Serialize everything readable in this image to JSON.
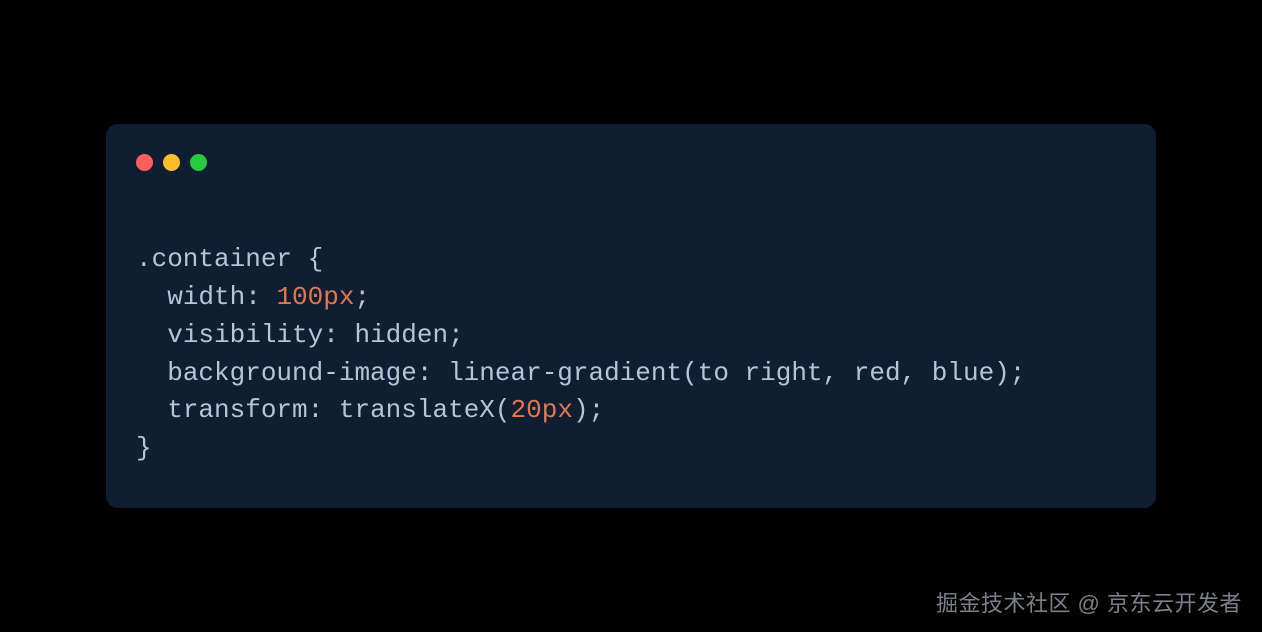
{
  "code": {
    "line1_selector": ".container",
    "line1_brace_open": " {",
    "line2_indent": "  ",
    "line2_prop": "width",
    "line2_colon": ": ",
    "line2_num": "100",
    "line2_unit": "px",
    "line2_semi": ";",
    "line3_indent": "  ",
    "line3_prop": "visibility",
    "line3_colon": ": ",
    "line3_val": "hidden",
    "line3_semi": ";",
    "line4_indent": "  ",
    "line4_prop": "background-image",
    "line4_colon": ": ",
    "line4_val": "linear-gradient(to right, red, blue)",
    "line4_semi": ";",
    "line5_indent": "  ",
    "line5_prop": "transform",
    "line5_colon": ": ",
    "line5_func": "translateX(",
    "line5_num": "20",
    "line5_unit": "px",
    "line5_close": ")",
    "line5_semi": ";",
    "line6_brace_close": "}"
  },
  "watermark": "掘金技术社区 @ 京东云开发者"
}
